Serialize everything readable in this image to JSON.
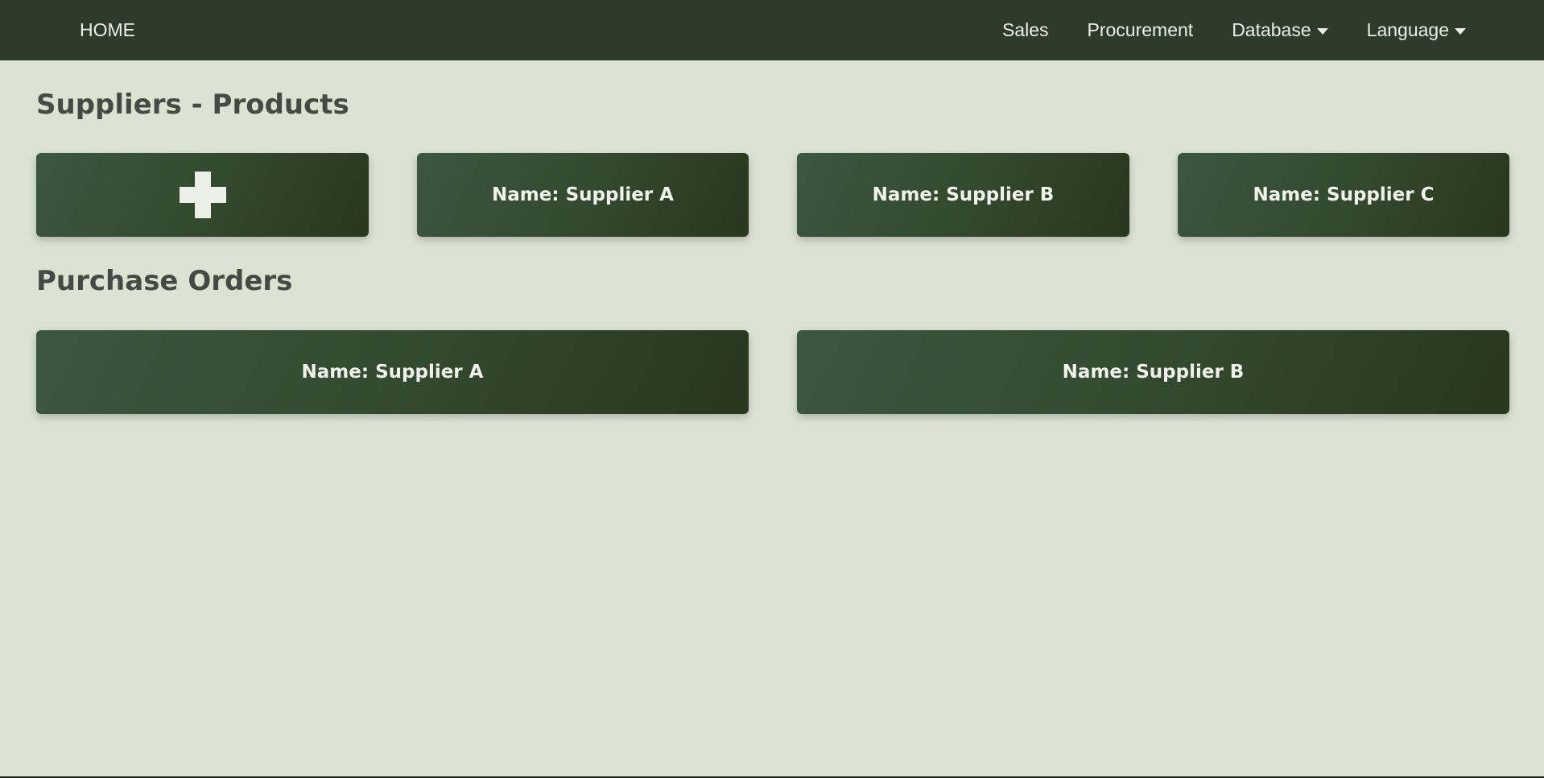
{
  "nav": {
    "home": "HOME",
    "items": [
      {
        "label": "Sales",
        "has_dropdown": false
      },
      {
        "label": "Procurement",
        "has_dropdown": false
      },
      {
        "label": "Database",
        "has_dropdown": true
      },
      {
        "label": "Language",
        "has_dropdown": true
      }
    ]
  },
  "suppliers_products": {
    "title": "Suppliers - Products",
    "add_icon": "plus-icon",
    "cards": [
      {
        "label": "Name: Supplier A"
      },
      {
        "label": "Name: Supplier B"
      },
      {
        "label": "Name: Supplier C"
      }
    ]
  },
  "purchase_orders": {
    "title": "Purchase Orders",
    "cards": [
      {
        "label": "Name: Supplier A"
      },
      {
        "label": "Name: Supplier B"
      }
    ]
  },
  "colors": {
    "navbar": "#2e3b2b",
    "background": "#dce3d3",
    "card_gradient_start": "#3b5740",
    "card_gradient_end": "#28371d",
    "heading_text": "#474a44"
  }
}
